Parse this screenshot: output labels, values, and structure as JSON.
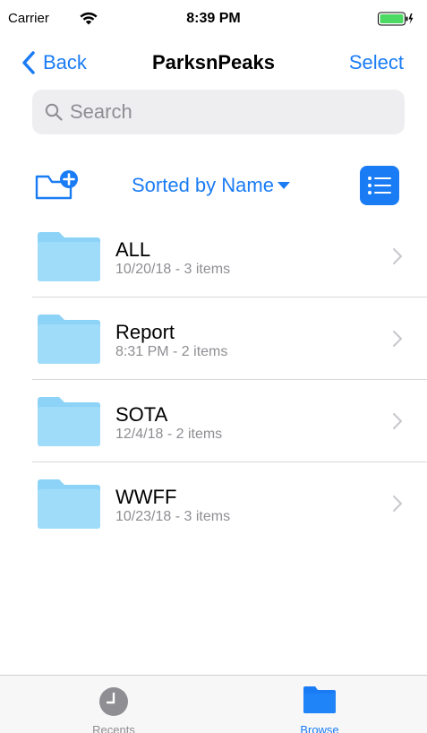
{
  "status_bar": {
    "carrier": "Carrier",
    "time": "8:39 PM",
    "battery_color": "#4cd964"
  },
  "nav": {
    "back_label": "Back",
    "title": "ParksnPeaks",
    "select_label": "Select"
  },
  "search": {
    "placeholder": "Search"
  },
  "toolbar": {
    "sort_label": "Sorted by Name"
  },
  "folders": [
    {
      "name": "ALL",
      "meta": "10/20/18 - 3 items"
    },
    {
      "name": "Report",
      "meta": "8:31 PM - 2 items"
    },
    {
      "name": "SOTA",
      "meta": "12/4/18 - 2 items"
    },
    {
      "name": "WWFF",
      "meta": "10/23/18 - 3 items"
    }
  ],
  "tabs": [
    {
      "label": "Recents",
      "icon": "clock-icon",
      "active": false
    },
    {
      "label": "Browse",
      "icon": "folder-icon",
      "active": true
    }
  ],
  "colors": {
    "accent": "#1a7cf5",
    "folder": "#8dd3f7",
    "inactive": "#8e8e93"
  }
}
